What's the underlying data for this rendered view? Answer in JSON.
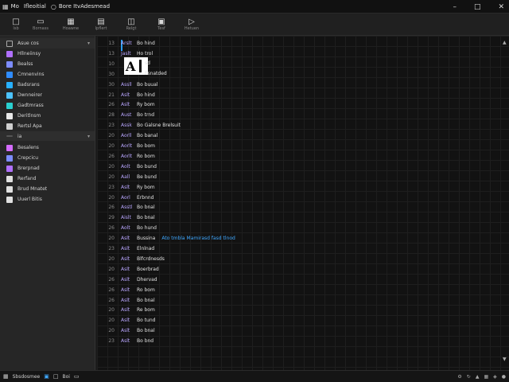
{
  "titlebar": {
    "app_name": "Mo",
    "menu_1": "Ifleoitial",
    "menu_2": "Bore ItvAdesmead"
  },
  "toolbar": {
    "tools": [
      {
        "label": "Isb",
        "icon": "document-icon"
      },
      {
        "label": "Bornass",
        "icon": "folder-icon"
      },
      {
        "label": "Hoawne",
        "icon": "table-icon"
      },
      {
        "label": "Ipflert",
        "icon": "chart-icon"
      },
      {
        "label": "Relgt",
        "icon": "hierarchy-icon"
      },
      {
        "label": "Tesf",
        "icon": "screen-icon"
      },
      {
        "label": "Hetuen",
        "icon": "pointer-icon"
      }
    ]
  },
  "sidebar": {
    "header": "Asue cos",
    "items": [
      {
        "label": "Hllneiinsy",
        "color": "#b070ff"
      },
      {
        "label": "Bealss",
        "color": "#7d8cff"
      },
      {
        "label": "Cmnenvins",
        "color": "#2f8cff"
      },
      {
        "label": "Badsrans",
        "color": "#27b0ff"
      },
      {
        "label": "Dwnneirer",
        "color": "#4cc3ff"
      },
      {
        "label": "Gadtmrass",
        "color": "#2ad0d0"
      },
      {
        "label": "Deritlnsm",
        "color": "#e8e8e8"
      },
      {
        "label": "Rertsl Apa",
        "color": "#cfcfcf"
      }
    ],
    "section_label": "ia",
    "items_2": [
      {
        "label": "Besalens",
        "color": "#d46cff"
      },
      {
        "label": "Crepcicu",
        "color": "#7d8cff"
      },
      {
        "label": "Brerpnad",
        "color": "#b070ff"
      },
      {
        "label": "Rerfand",
        "color": "#e0e0e0"
      },
      {
        "label": "Brud Mnatet",
        "color": "#e0e0e0"
      },
      {
        "label": "Uuerl Bitis",
        "color": "#e0e0e0"
      }
    ]
  },
  "editor": {
    "cover_letter": "A",
    "cover_lines": [
      "sd",
      "Fsnatded"
    ],
    "rows": [
      {
        "num": "13",
        "kw": "Arslt",
        "text": "Bo hind"
      },
      {
        "num": "13",
        "kw": "Jaslt",
        "text": "Ho trol"
      },
      {
        "num": "10",
        "kw": "",
        "text": ""
      },
      {
        "num": "30",
        "kw": "",
        "text": ""
      },
      {
        "num": "30",
        "kw": "Assll",
        "text": "Bo buual"
      },
      {
        "num": "21",
        "kw": "Aslt",
        "text": "Bo hind"
      },
      {
        "num": "26",
        "kw": "Aslt",
        "text": "Ry bom"
      },
      {
        "num": "28",
        "kw": "Aust",
        "text": "Bo trnd"
      },
      {
        "num": "23",
        "kw": "Assk",
        "text": "Bo Galsne Brelsuit"
      },
      {
        "num": "20",
        "kw": "Aorll",
        "text": "Bo banal"
      },
      {
        "num": "20",
        "kw": "Aorlt",
        "text": "Bo bom"
      },
      {
        "num": "26",
        "kw": "Aorlt",
        "text": "Ro bom"
      },
      {
        "num": "20",
        "kw": "Aolt",
        "text": "Bo bund"
      },
      {
        "num": "20",
        "kw": "Aall",
        "text": "Be bund"
      },
      {
        "num": "23",
        "kw": "Aslt",
        "text": "Ry bom"
      },
      {
        "num": "20",
        "kw": "Aorl",
        "text": "Erbnnd"
      },
      {
        "num": "26",
        "kw": "Asstl",
        "text": "Bo bnal"
      },
      {
        "num": "29",
        "kw": "Aislt",
        "text": "Bo bnal"
      },
      {
        "num": "26",
        "kw": "Aolt",
        "text": "Bo hund"
      },
      {
        "num": "20",
        "kw": "Aslt",
        "text": "Bussina",
        "extra": "Ato tmbla Mamirasd fasd tlnod"
      },
      {
        "num": "23",
        "kw": "Aslt",
        "text": "Elnlnad"
      },
      {
        "num": "20",
        "kw": "Aslt",
        "text": "Blfcrdnesds"
      },
      {
        "num": "20",
        "kw": "Aslt",
        "text": "Boerbrad"
      },
      {
        "num": "26",
        "kw": "Aslt",
        "text": "Dhervad"
      },
      {
        "num": "26",
        "kw": "Aslt",
        "text": "Ro bom"
      },
      {
        "num": "26",
        "kw": "Aslt",
        "text": "Bo bnal"
      },
      {
        "num": "20",
        "kw": "Aslt",
        "text": "Re bom"
      },
      {
        "num": "20",
        "kw": "Aslt",
        "text": "Bo tund"
      },
      {
        "num": "20",
        "kw": "Aslt",
        "text": "Bo bnal"
      },
      {
        "num": "23",
        "kw": "Aslt",
        "text": "Bo bnd"
      }
    ]
  },
  "status": {
    "left_label": "Sbsdosmee",
    "count": "Boi"
  }
}
